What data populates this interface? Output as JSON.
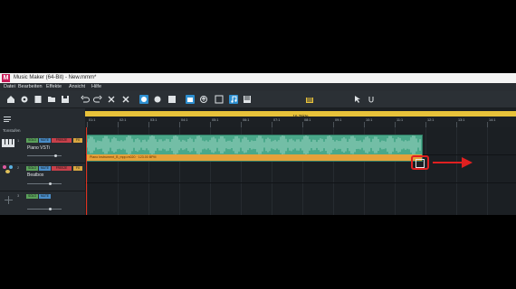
{
  "window": {
    "title": "Music Maker (64-Bit) - New.mmm*",
    "app_icon": "M",
    "accent_color": "#c81e5a"
  },
  "menu": [
    "Datei",
    "Bearbeiten",
    "Effekte",
    "Ansicht",
    "Hilfe"
  ],
  "toolbar": {
    "icons": [
      "home-icon",
      "settings-icon",
      "import-icon",
      "folder-icon",
      "save-icon",
      "undo-icon",
      "redo-icon",
      "cut-icon",
      "delete-icon",
      "copy-icon",
      "toggle-icon",
      "record-icon",
      "store-icon",
      "upload-icon",
      "loop-icon",
      "music-icon",
      "piano-icon",
      "mixer-icon",
      "pointer-icon",
      "tool-mode-icon"
    ]
  },
  "ruler": {
    "length_label": "16 Takte",
    "ticks": [
      "01:1",
      "02:1",
      "03:1",
      "04:1",
      "05:1",
      "06:1",
      "07:1",
      "08:1",
      "09:1",
      "10:1",
      "11:1",
      "12:1",
      "13:1",
      "14:1",
      "15:1"
    ]
  },
  "sidebar": {
    "menu_icon": "hamburger-icon",
    "tonspur_label": "Tonstufen"
  },
  "tracks": [
    {
      "number": "1",
      "name": "Piano VSTi",
      "icon": "piano-icon",
      "buttons": [
        "SOLO",
        "MUTE",
        "FREEZE",
        "FX"
      ]
    },
    {
      "number": "2",
      "name": "Beatbox",
      "icon": "drum-icon",
      "buttons": [
        "SOLO",
        "MUTE",
        "FREEZE",
        "FX"
      ]
    },
    {
      "number": "3",
      "name": "",
      "icon": "add-icon",
      "buttons": [
        "SOLO",
        "MUTE"
      ]
    }
  ],
  "clip": {
    "name": "Piano Instrument_B_mpp.m020 · 123.00 BPM",
    "color": "#4aa88a",
    "footer_color": "#e6a13a"
  },
  "annotation": {
    "highlight_color": "#e02020"
  }
}
